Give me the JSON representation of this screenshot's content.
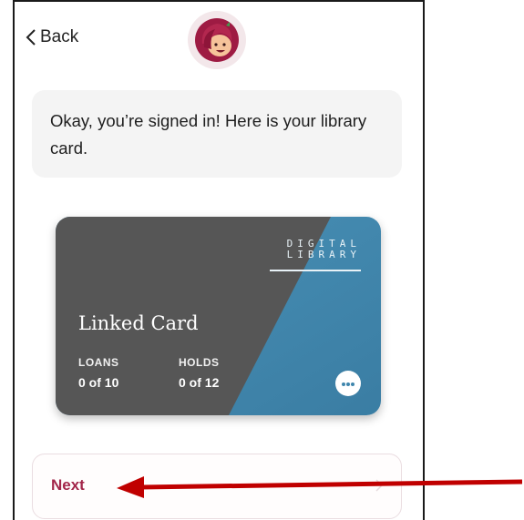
{
  "header": {
    "back_label": "Back"
  },
  "message": {
    "text": "Okay, you’re signed in! Here is your library card."
  },
  "card": {
    "brand_line1": "DIGITAL",
    "brand_line2": "LIBRARY",
    "name": "Linked Card",
    "loans_label": "LOANS",
    "loans_value": "0 of 10",
    "holds_label": "HOLDS",
    "holds_value": "0 of 12",
    "colors": {
      "dark": "#555555",
      "blue": "#3f86ad"
    }
  },
  "actions": {
    "next_label": "Next"
  },
  "annotation": {
    "arrow_color": "#c00000"
  },
  "icons": [
    "chevron-left-icon",
    "app-logo-icon",
    "more-options-icon",
    "chevron-right-icon",
    "annotation-arrow"
  ]
}
